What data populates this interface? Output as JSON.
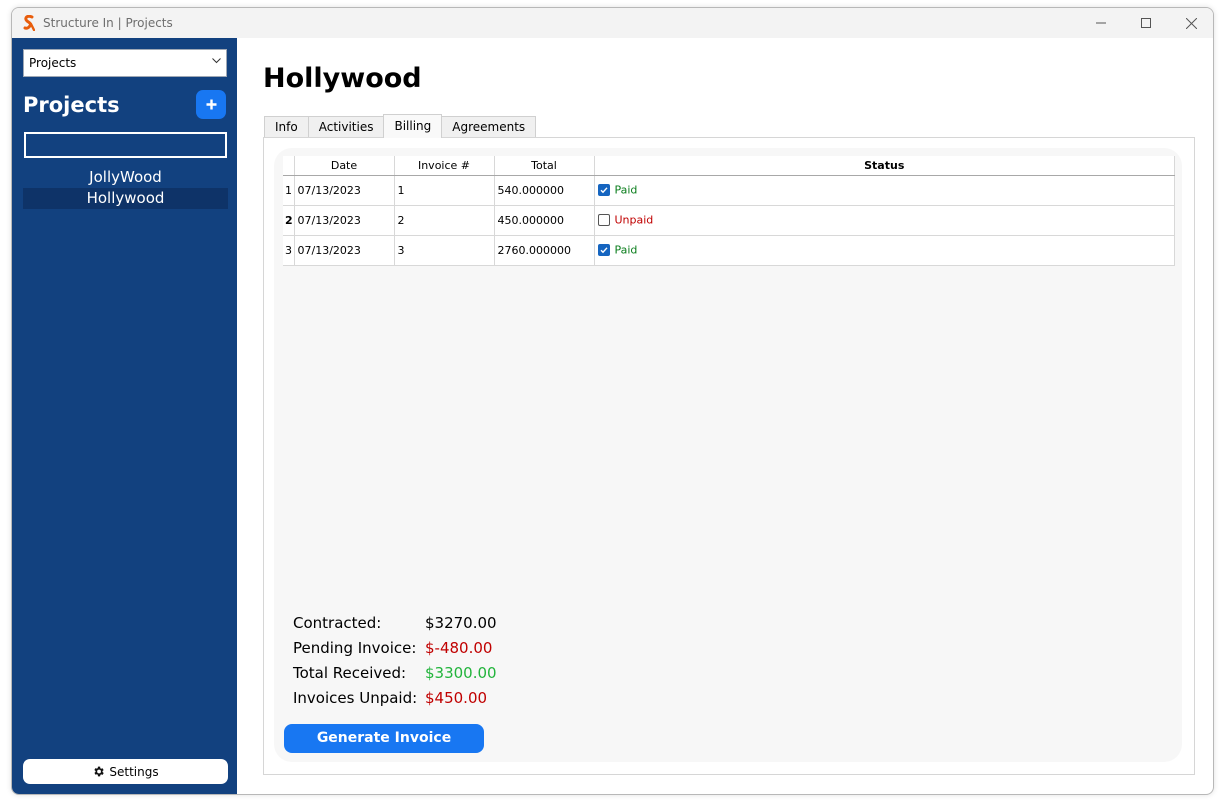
{
  "window": {
    "title": "Structure In | Projects"
  },
  "sidebar": {
    "select_value": "Projects",
    "heading": "Projects",
    "add_label": "+",
    "search_value": "",
    "projects": [
      {
        "label": "JollyWood",
        "selected": false
      },
      {
        "label": "Hollywood",
        "selected": true
      }
    ],
    "settings_label": "Settings"
  },
  "main": {
    "title": "Hollywood",
    "tabs": [
      {
        "label": "Info",
        "active": false
      },
      {
        "label": "Activities",
        "active": false
      },
      {
        "label": "Billing",
        "active": true
      },
      {
        "label": "Agreements",
        "active": false
      }
    ],
    "table": {
      "headers": {
        "date": "Date",
        "invoice": "Invoice #",
        "total": "Total",
        "status": "Status"
      },
      "rows": [
        {
          "num": "1",
          "date": "07/13/2023",
          "invoice": "1",
          "total": "540.000000",
          "paid": true,
          "status": "Paid"
        },
        {
          "num": "2",
          "date": "07/13/2023",
          "invoice": "2",
          "total": "450.000000",
          "paid": false,
          "status": "Unpaid"
        },
        {
          "num": "3",
          "date": "07/13/2023",
          "invoice": "3",
          "total": "2760.000000",
          "paid": true,
          "status": "Paid"
        }
      ]
    },
    "summary": [
      {
        "label": "Contracted:",
        "value": "$3270.00",
        "color": "#000000"
      },
      {
        "label": "Pending Invoice:",
        "value": "$-480.00",
        "color": "#c00000"
      },
      {
        "label": "Total Received:",
        "value": "$3300.00",
        "color": "#22b43c"
      },
      {
        "label": "Invoices Unpaid:",
        "value": "$450.00",
        "color": "#c00000"
      }
    ],
    "generate_label": "Generate Invoice"
  },
  "colors": {
    "sidebar": "#12417f",
    "accent": "#1877f2",
    "paid": "#0a7d1c",
    "unpaid": "#c00000"
  }
}
